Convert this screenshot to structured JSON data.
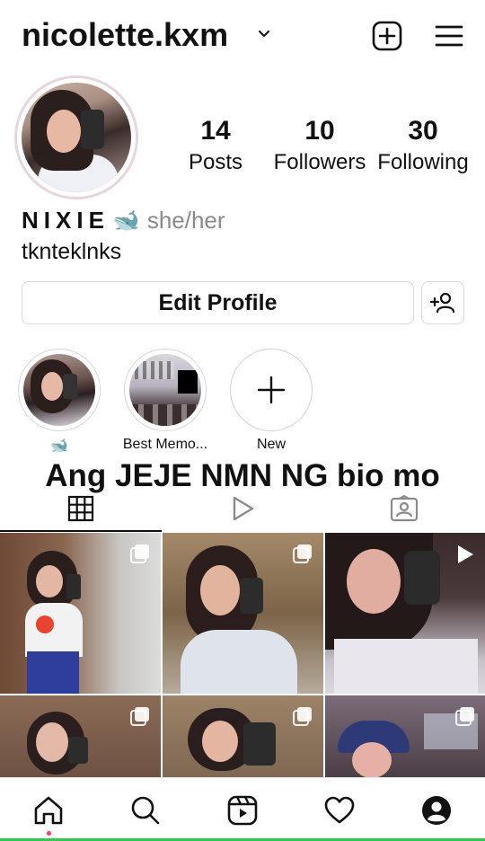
{
  "header": {
    "username": "nicolette.kxm",
    "icons": [
      "chevron-down-icon",
      "add-post-icon",
      "menu-icon"
    ]
  },
  "profile": {
    "stats": [
      {
        "value": "14",
        "label": "Posts"
      },
      {
        "value": "10",
        "label": "Followers"
      },
      {
        "value": "30",
        "label": "Following"
      }
    ],
    "display_name": "NIXIE",
    "name_emoji": "🐋",
    "pronouns": "she/her",
    "bio": "tknteklnks"
  },
  "actions": {
    "edit_profile_label": "Edit Profile",
    "add_user_icon": "add-person-icon"
  },
  "highlights": [
    {
      "label": "🐋"
    },
    {
      "label": "Best Memo..."
    },
    {
      "label": "New"
    }
  ],
  "overlay_caption": "Ang JEJE NMN NG bio mo",
  "tabs": [
    {
      "icon": "grid-icon",
      "active": true
    },
    {
      "icon": "reels-icon",
      "active": false
    },
    {
      "icon": "tagged-icon",
      "active": false
    }
  ],
  "grid_posts": [
    {
      "badge": "multi-icon"
    },
    {
      "badge": "multi-icon"
    },
    {
      "badge": "play-icon"
    },
    {
      "badge": "multi-icon"
    },
    {
      "badge": "multi-icon"
    },
    {
      "badge": "multi-icon"
    }
  ],
  "bottom_nav": [
    "home-icon",
    "search-icon",
    "reels-icon",
    "heart-icon",
    "profile-icon"
  ],
  "colors": {
    "notification_dot": "#ff3b5c",
    "home_indicator": "#33c94a"
  }
}
